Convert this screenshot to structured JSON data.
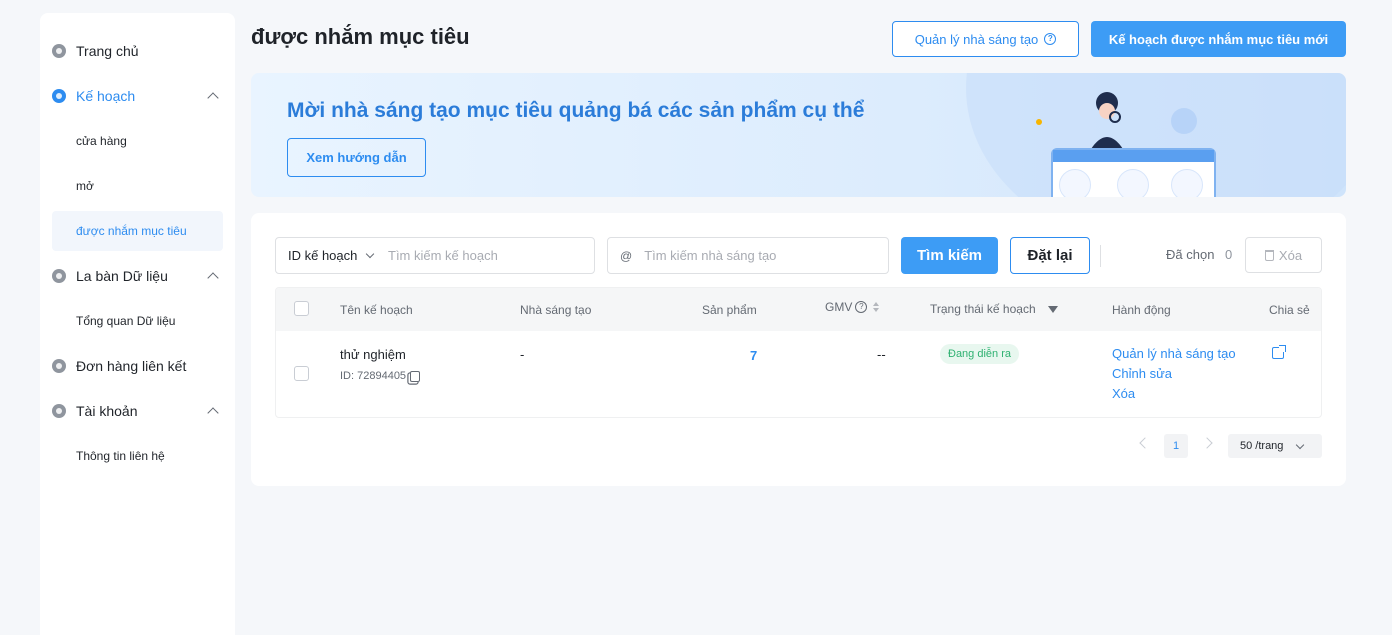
{
  "sidebar": {
    "items": [
      {
        "label": "Trang chủ"
      },
      {
        "label": "Kế hoạch",
        "children": [
          "cửa hàng",
          "mở",
          "được nhắm mục tiêu"
        ]
      },
      {
        "label": "La bàn Dữ liệu",
        "children": [
          "Tổng quan Dữ liệu"
        ]
      },
      {
        "label": "Đơn hàng liên kết"
      },
      {
        "label": "Tài khoản",
        "children": [
          "Thông tin liên hệ"
        ]
      }
    ]
  },
  "header": {
    "title": "được nhắm mục tiêu",
    "manage_creators_label": "Quản lý nhà sáng tạo",
    "new_plan_label": "Kế hoạch được nhắm mục tiêu mới"
  },
  "banner": {
    "title": "Mời nhà sáng tạo mục tiêu quảng bá các sản phẩm cụ thể",
    "guide_label": "Xem hướng dẫn"
  },
  "filters": {
    "plan_id_select": "ID kế hoạch",
    "plan_search_placeholder": "Tìm kiếm kế hoạch",
    "creator_prefix": "@",
    "creator_search_placeholder": "Tìm kiếm nhà sáng tạo",
    "search_label": "Tìm kiếm",
    "reset_label": "Đặt lại",
    "selected_label": "Đã chọn",
    "selected_count": "0",
    "delete_label": "Xóa"
  },
  "table": {
    "columns": [
      "Tên kế hoạch",
      "Nhà sáng tạo",
      "Sản phẩm",
      "GMV",
      "Trạng thái kế hoạch",
      "Hành động",
      "Chia sẻ"
    ],
    "rows": [
      {
        "name": "thử nghiệm",
        "id": "ID: 72894405",
        "creator": "-",
        "products": "7",
        "gmv": "--",
        "status": "Đang diễn ra",
        "actions": [
          "Quản lý nhà sáng tạo",
          "Chỉnh sửa",
          "Xóa"
        ]
      }
    ]
  },
  "pagination": {
    "current_page": "1",
    "per_page": "50 /trang"
  },
  "colors": {
    "primary": "#3d9cf5",
    "link": "#2d8cf0",
    "status_green": "#2fb171"
  }
}
